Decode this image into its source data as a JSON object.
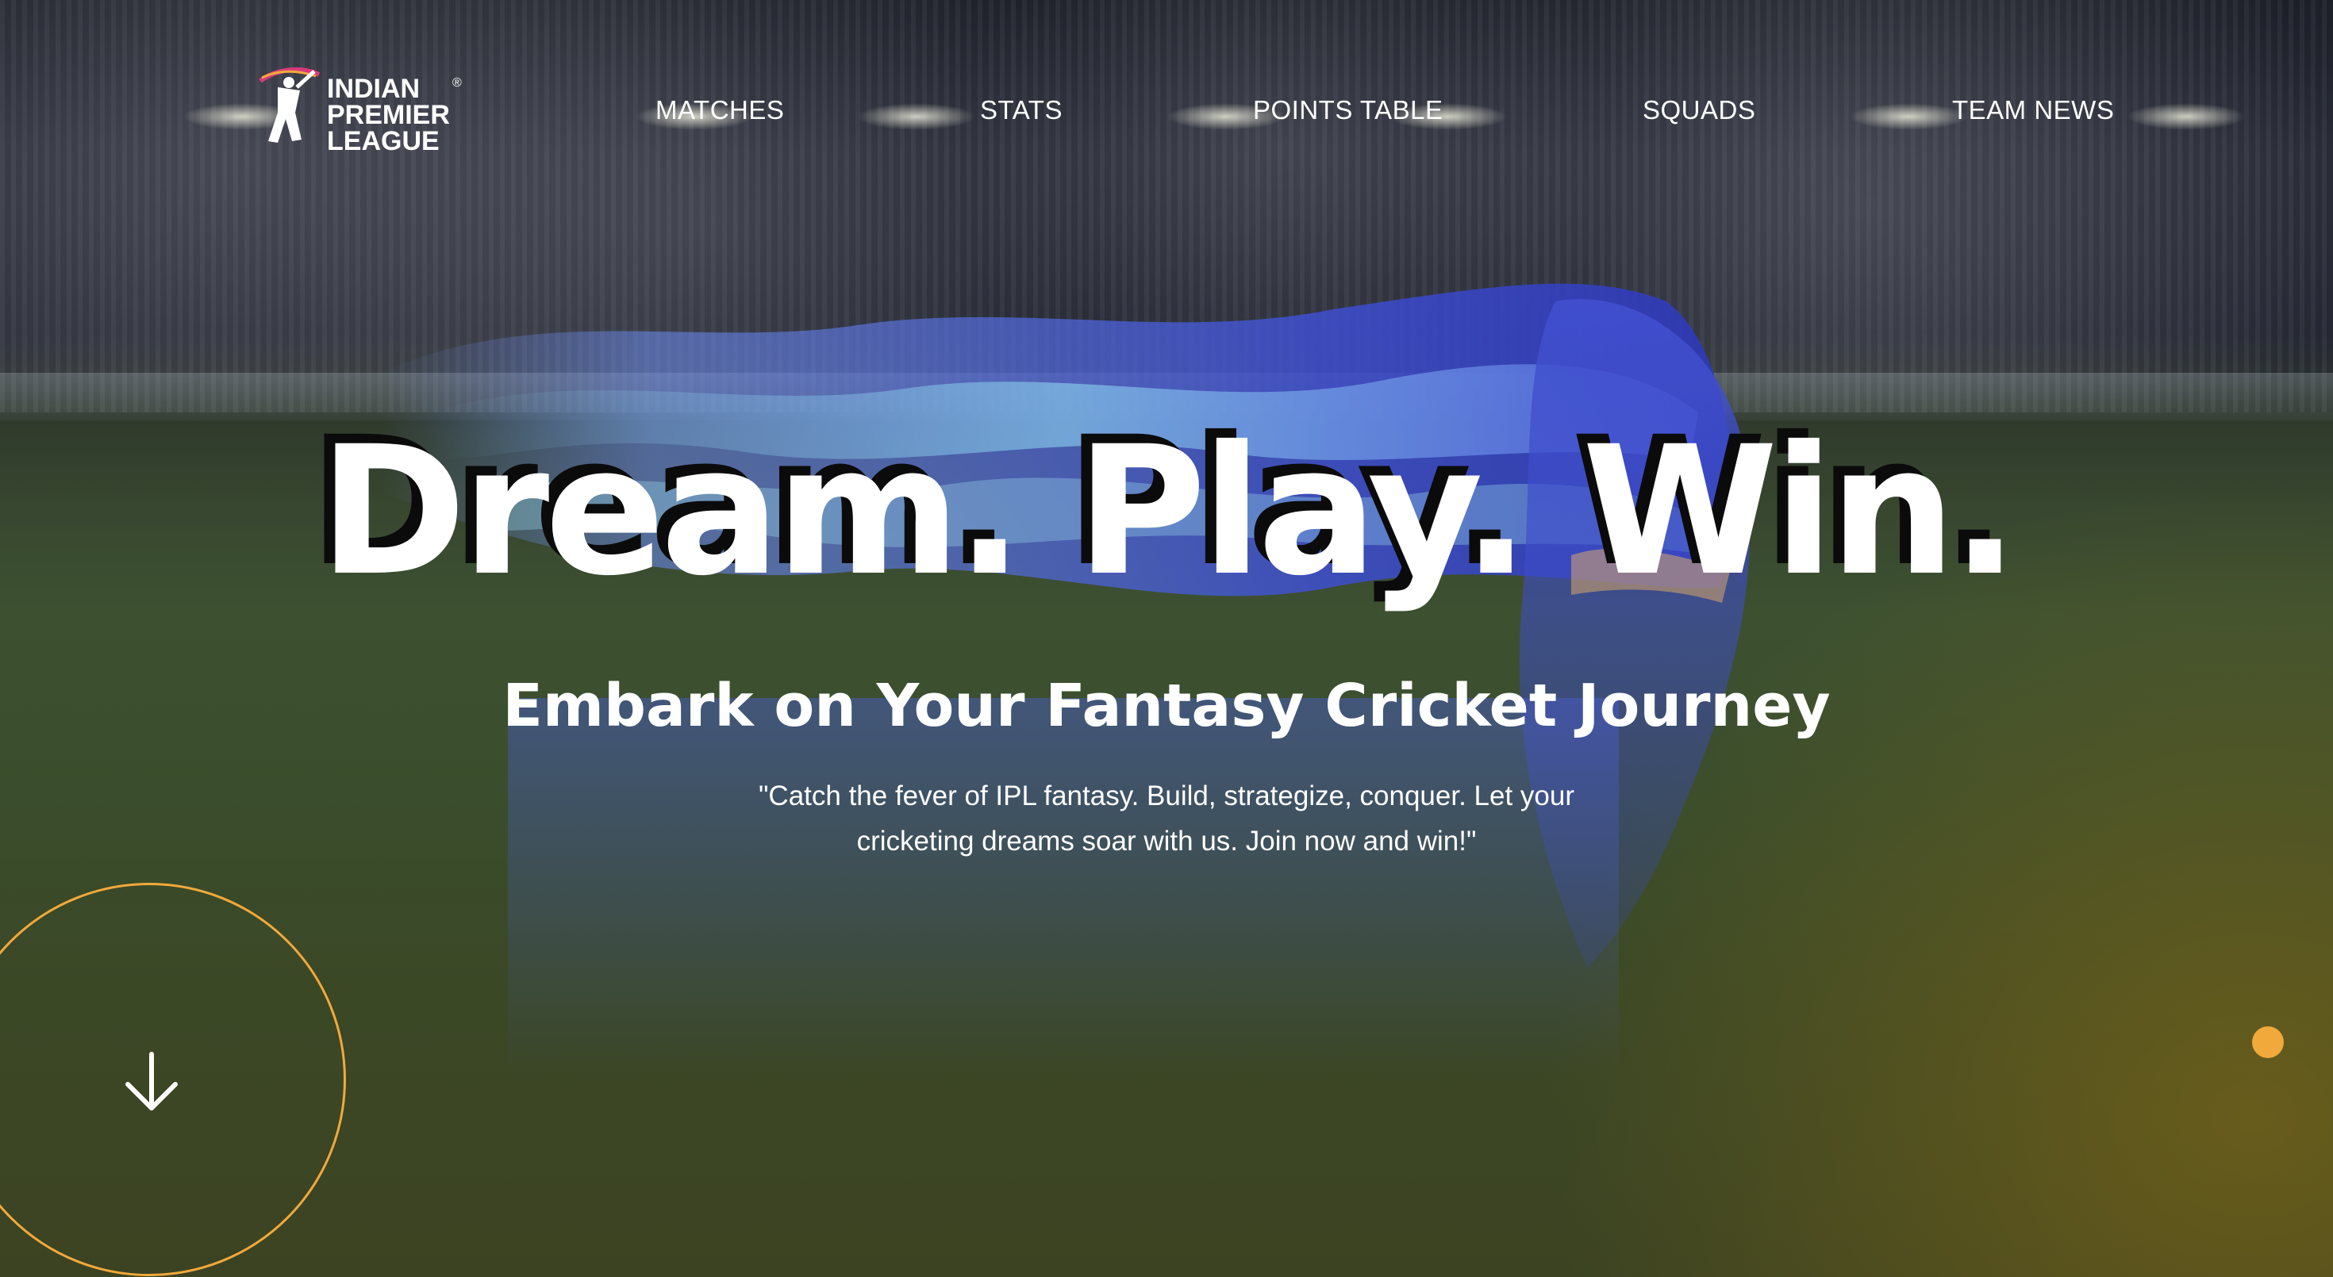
{
  "brand": {
    "logo_lines": [
      "INDIAN",
      "PREMIER",
      "LEAGUE"
    ],
    "registered_mark": "®"
  },
  "nav": {
    "items": [
      {
        "label": "MATCHES"
      },
      {
        "label": "STATS"
      },
      {
        "label": "POINTS TABLE"
      },
      {
        "label": "SQUADS"
      },
      {
        "label": "TEAM NEWS"
      }
    ]
  },
  "hero": {
    "headline": "Dream. Play. Win.",
    "subheadline": "Embark on Your Fantasy Cricket Journey",
    "tagline_line1": "\"Catch the fever of IPL fantasy. Build, strategize, conquer. Let your",
    "tagline_line2": "cricketing dreams soar with us. Join now and win!\""
  },
  "controls": {
    "scroll_icon": "arrow-down-icon"
  },
  "colors": {
    "accent": "#f2a93b",
    "text": "#ffffff",
    "streak_blue": "#4b5fd6",
    "field_green": "#3d5131"
  }
}
